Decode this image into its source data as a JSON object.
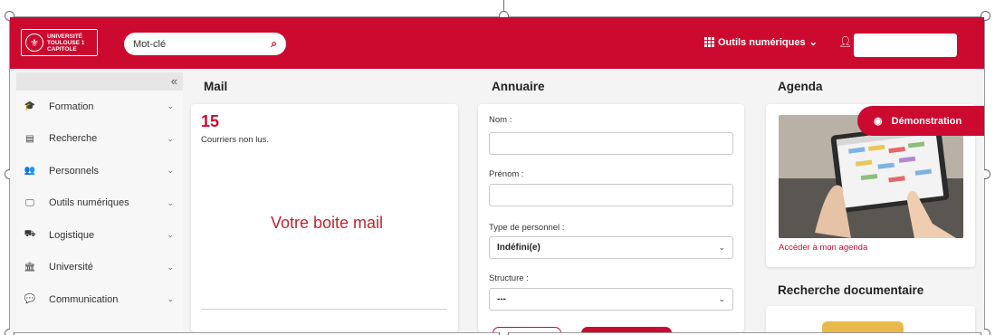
{
  "colors": {
    "brand": "#cc0a2f",
    "accent_text": "#c0252f"
  },
  "header": {
    "logo_lines": "UNIVERSITÉ\nTOULOUSE 1\nCAPITOLE",
    "search_placeholder": "Mot-clé",
    "search_icon": "search-icon",
    "tools_label": "Outils numériques",
    "tools_chevron": "⌄",
    "user_icon": "user-icon"
  },
  "sidebar": {
    "collapse_glyph": "«",
    "items": [
      {
        "label": "Formation",
        "icon": "graduation-cap-icon",
        "glyph": "🎓"
      },
      {
        "label": "Recherche",
        "icon": "book-icon",
        "glyph": "▤"
      },
      {
        "label": "Personnels",
        "icon": "users-icon",
        "glyph": "👥"
      },
      {
        "label": "Outils numériques",
        "icon": "monitor-icon",
        "glyph": "🖵"
      },
      {
        "label": "Logistique",
        "icon": "dolly-icon",
        "glyph": "⛟"
      },
      {
        "label": "Université",
        "icon": "university-icon",
        "glyph": "🏛"
      },
      {
        "label": "Communication",
        "icon": "comments-icon",
        "glyph": "💬"
      }
    ]
  },
  "mail": {
    "title": "Mail",
    "count": "15",
    "subtitle": "Courriers non lus.",
    "center_text": "Votre boite mail"
  },
  "annuaire": {
    "title": "Annuaire",
    "nom_label": "Nom :",
    "prenom_label": "Prénom :",
    "type_label": "Type de personnel :",
    "type_value": "Indéfini(e)",
    "structure_label": "Structure :",
    "structure_value": "---"
  },
  "agenda": {
    "title": "Agenda",
    "link": "Accéder à mon agenda",
    "demo_label": "Démonstration"
  },
  "docs": {
    "title": "Recherche documentaire"
  }
}
